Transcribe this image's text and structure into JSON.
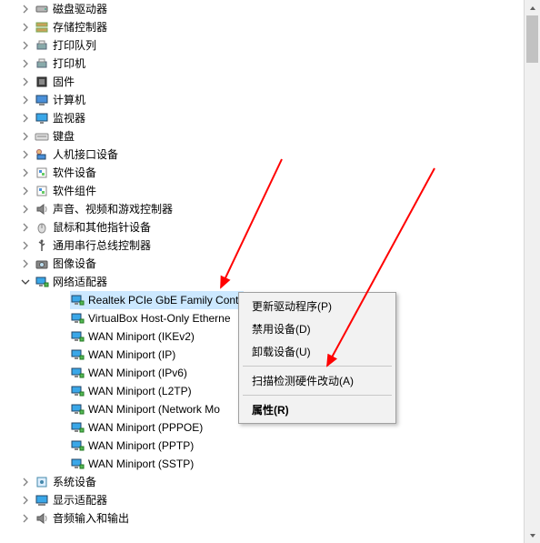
{
  "colors": {
    "selection": "#cce8ff",
    "arrow": "#ff0000"
  },
  "categories": [
    {
      "icon": "disk-drive-icon",
      "label": "磁盘驱动器",
      "expanded": false
    },
    {
      "icon": "storage-icon",
      "label": "存储控制器",
      "expanded": false
    },
    {
      "icon": "print-queue-icon",
      "label": "打印队列",
      "expanded": false
    },
    {
      "icon": "printer-icon",
      "label": "打印机",
      "expanded": false
    },
    {
      "icon": "firmware-icon",
      "label": "固件",
      "expanded": false
    },
    {
      "icon": "computer-icon",
      "label": "计算机",
      "expanded": false
    },
    {
      "icon": "monitor-icon",
      "label": "监视器",
      "expanded": false
    },
    {
      "icon": "keyboard-icon",
      "label": "键盘",
      "expanded": false
    },
    {
      "icon": "hid-icon",
      "label": "人机接口设备",
      "expanded": false
    },
    {
      "icon": "software-icon",
      "label": "软件设备",
      "expanded": false
    },
    {
      "icon": "software-comp-icon",
      "label": "软件组件",
      "expanded": false
    },
    {
      "icon": "audio-icon",
      "label": "声音、视频和游戏控制器",
      "expanded": false
    },
    {
      "icon": "mouse-icon",
      "label": "鼠标和其他指针设备",
      "expanded": false
    },
    {
      "icon": "usb-icon",
      "label": "通用串行总线控制器",
      "expanded": false
    },
    {
      "icon": "imaging-icon",
      "label": "图像设备",
      "expanded": false
    },
    {
      "icon": "network-icon",
      "label": "网络适配器",
      "expanded": true,
      "children": [
        {
          "label": "Realtek PCIe GbE Family Controller",
          "selected": true
        },
        {
          "label": "VirtualBox Host-Only Ethernet Adapter"
        },
        {
          "label": "WAN Miniport (IKEv2)"
        },
        {
          "label": "WAN Miniport (IP)"
        },
        {
          "label": "WAN Miniport (IPv6)"
        },
        {
          "label": "WAN Miniport (L2TP)"
        },
        {
          "label": "WAN Miniport (Network Monitor)"
        },
        {
          "label": "WAN Miniport (PPPOE)"
        },
        {
          "label": "WAN Miniport (PPTP)"
        },
        {
          "label": "WAN Miniport (SSTP)"
        }
      ]
    },
    {
      "icon": "system-icon",
      "label": "系统设备",
      "expanded": false
    },
    {
      "icon": "display-icon",
      "label": "显示适配器",
      "expanded": false
    },
    {
      "icon": "audio-io-icon",
      "label": "音频输入和输出",
      "expanded": false
    }
  ],
  "selected_display": "Realtek PCIe GbE Family Cont",
  "child_display": {
    "1": "VirtualBox Host-Only Etherne",
    "6": "WAN Miniport (Network Mo"
  },
  "context_menu": {
    "items": [
      {
        "label": "更新驱动程序(P)"
      },
      {
        "label": "禁用设备(D)"
      },
      {
        "label": "卸载设备(U)"
      },
      {
        "sep": true
      },
      {
        "label": "扫描检测硬件改动(A)"
      },
      {
        "sep": true
      },
      {
        "label": "属性(R)",
        "bold": true
      }
    ]
  }
}
